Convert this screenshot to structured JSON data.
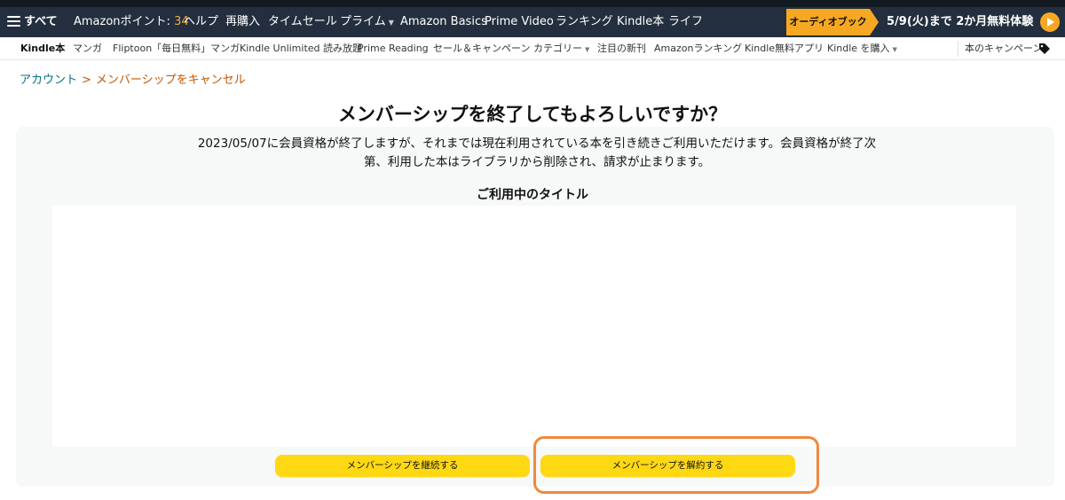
{
  "topnav": {
    "all_label": "すべて",
    "points_label": "Amazonポイント: ",
    "points_value": "34",
    "items": [
      "ヘルプ",
      "再購入",
      "タイムセール",
      "プライム",
      "Amazon Basics",
      "Prime Video",
      "ランキング",
      "Kindle本",
      "ライフ"
    ],
    "promo_tag": "オーディオブック",
    "promo_text": "5/9(火)まで 2か月無料体験",
    "colors": {
      "bar": "#232f3e",
      "accent": "#f7a823"
    }
  },
  "subnav": {
    "items": [
      "Kindle本",
      "マンガ",
      "Fliptoon「毎日無料」マンガ",
      "Kindle Unlimited 読み放題",
      "Prime Reading",
      "セール＆キャンペーン",
      "カテゴリー",
      "注目の新刊",
      "Amazonランキング",
      "Kindle無料アプリ",
      "Kindle を購入"
    ],
    "right_item": "本のキャンペーン"
  },
  "breadcrumb": {
    "link": "アカウント",
    "separator": ">",
    "current": "メンバーシップをキャンセル"
  },
  "main": {
    "title": "メンバーシップを終了してもよろしいですか？",
    "description_line1": "2023/05/07に会員資格が終了しますが、それまでは現在利用されている本を引き続きご利用いただけます。会員資格が終了次",
    "description_line2": "第、利用した本はライブラリから削除され、請求が止まります。",
    "titles_heading": "ご利用中のタイトル",
    "continue_button": "メンバーシップを継続する",
    "cancel_button": "メンバーシップを解約する",
    "button_color": "#ffd814",
    "highlight_color": "#f0883e"
  }
}
